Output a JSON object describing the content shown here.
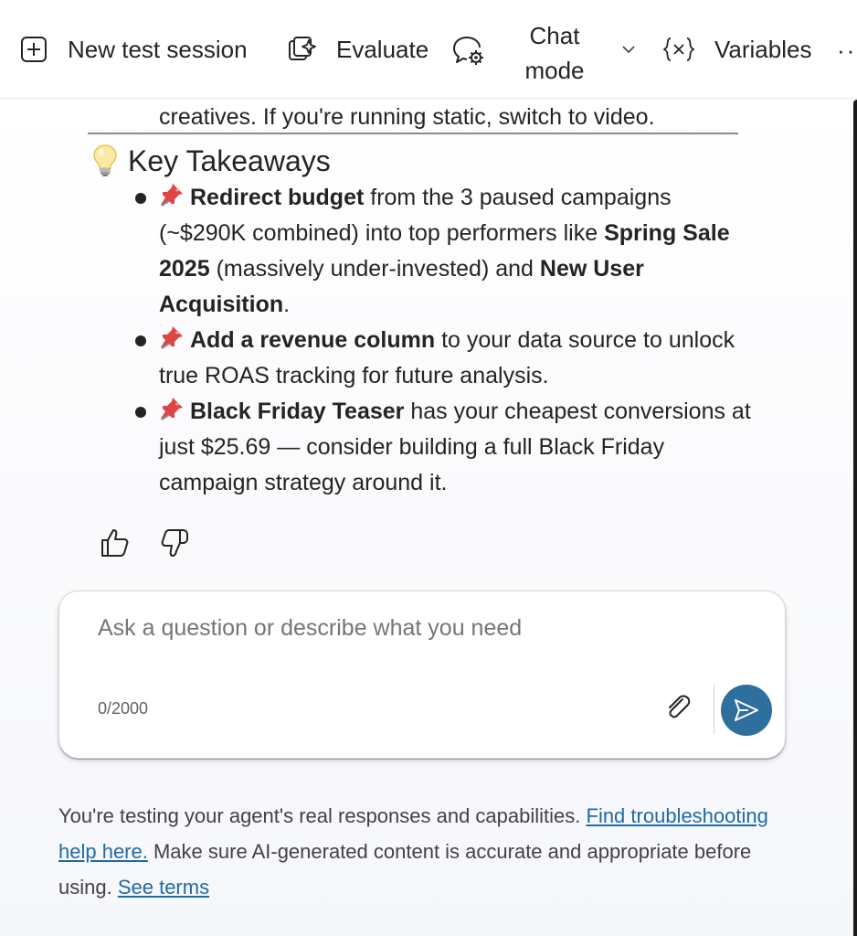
{
  "toolbar": {
    "new_session_label": "New test session",
    "evaluate_label": "Evaluate",
    "chat_mode_label": "Chat mode",
    "variables_label": "Variables",
    "more_label": "··"
  },
  "message": {
    "previous_line": "creatives. If you're running static, switch to video.",
    "heading": "Key Takeaways",
    "items": [
      {
        "bold1": "Redirect budget",
        "text1": " from the 3 paused campaigns (~$290K combined) into top performers like ",
        "bold2": "Spring Sale 2025",
        "text2": " (massively under-invested) and ",
        "bold3": "New User Acquisition",
        "text3": "."
      },
      {
        "bold1": "Add a revenue column",
        "text1": " to your data source to unlock true ROAS tracking for future analysis."
      },
      {
        "bold1": "Black Friday Teaser",
        "text1": " has your cheapest conversions at just $25.69 — consider building a full Black Friday campaign strategy around it."
      }
    ]
  },
  "input": {
    "placeholder": "Ask a question or describe what you need",
    "counter": "0/2000"
  },
  "footer": {
    "text1": "You're testing your agent's real responses and capabilities. ",
    "link1": "Find troubleshooting help here.",
    "text2": " Make sure AI-generated content is accurate and appropriate before using. ",
    "link2": "See terms"
  },
  "colors": {
    "send_button": "#2f6f9e",
    "link": "#1f6aa5"
  },
  "icons": [
    "add-square-icon",
    "evaluate-sparkle-icon",
    "chat-settings-icon",
    "chevron-down-icon",
    "variables-icon",
    "lightbulb-icon",
    "pushpin-icon",
    "thumbs-up-icon",
    "thumbs-down-icon",
    "attach-icon",
    "send-icon"
  ]
}
